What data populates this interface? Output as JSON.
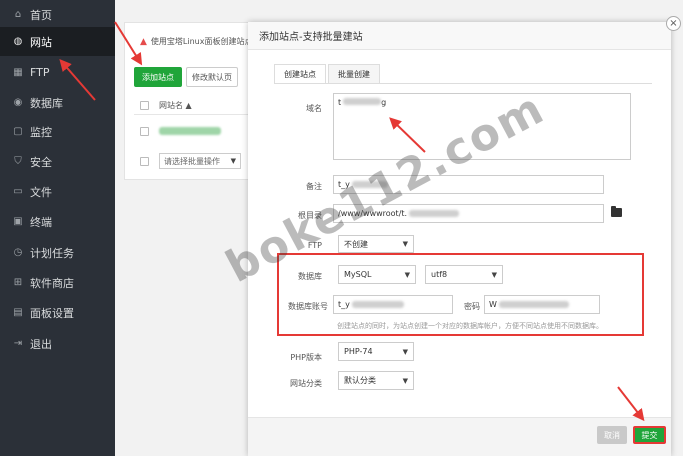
{
  "sidebar": {
    "items": [
      {
        "label": "首页",
        "icon": "home-icon"
      },
      {
        "label": "网站",
        "icon": "globe-icon"
      },
      {
        "label": "FTP",
        "icon": "ftp-icon"
      },
      {
        "label": "数据库",
        "icon": "database-icon"
      },
      {
        "label": "监控",
        "icon": "monitor-icon"
      },
      {
        "label": "安全",
        "icon": "shield-icon"
      },
      {
        "label": "文件",
        "icon": "folder-icon"
      },
      {
        "label": "终端",
        "icon": "terminal-icon"
      },
      {
        "label": "计划任务",
        "icon": "clock-icon"
      },
      {
        "label": "软件商店",
        "icon": "grid-icon"
      },
      {
        "label": "面板设置",
        "icon": "settings-icon"
      },
      {
        "label": "退出",
        "icon": "logout-icon"
      }
    ],
    "active_index": 1
  },
  "background": {
    "warning": "使用宝塔Linux面板创建站点",
    "add_button": "添加站点",
    "default_page_button": "修改默认页",
    "column_site_name": "网站名 ▲",
    "batch_placeholder": "请选择批量操作"
  },
  "modal": {
    "title": "添加站点-支持批量建站",
    "tabs": [
      "创建站点",
      "批量创建"
    ],
    "domain_label": "域名",
    "domain_value_start": "t",
    "domain_value_end": "g",
    "remark_label": "备注",
    "remark_value": "t_y",
    "root_label": "根目录",
    "root_value": "/www/wwwroot/t.",
    "ftp_label": "FTP",
    "ftp_value": "不创建",
    "db_label": "数据库",
    "db_type": "MySQL",
    "db_charset": "utf8",
    "db_user_label": "数据库账号",
    "db_user_value": "t_y",
    "db_pass_label": "密码",
    "db_pass_value": "W",
    "db_hint": "创建站点的同时，为站点创建一个对应的数据库帐户，方便不同站点使用不同数据库。",
    "php_label": "PHP版本",
    "php_value": "PHP-74",
    "category_label": "网站分类",
    "category_value": "默认分类",
    "cancel_button": "取消",
    "submit_button": "提交",
    "close_glyph": "×"
  },
  "watermark": "boke112.com",
  "colors": {
    "accent_green": "#20a53a",
    "highlight_red": "#e53935",
    "sidebar_bg": "#2b3038"
  }
}
